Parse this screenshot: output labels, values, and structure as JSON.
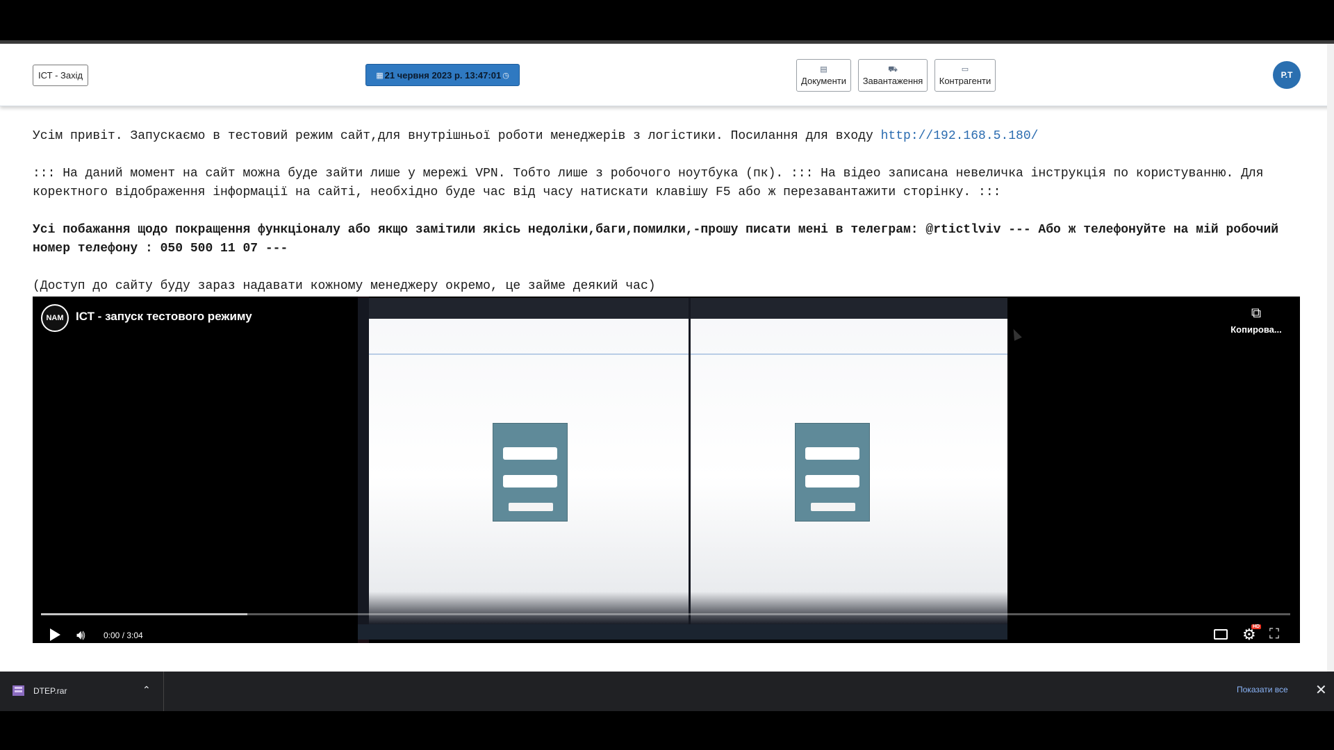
{
  "navbar": {
    "brand": "ІСТ - Захід",
    "datetime": "21 червня 2023 р. 13:47:01",
    "buttons": [
      {
        "label": "Документи",
        "icon": "document-icon"
      },
      {
        "label": "Завантаження",
        "icon": "truck-icon"
      },
      {
        "label": "Контрагенти",
        "icon": "contacts-icon"
      }
    ],
    "user_initials": "Р.Т"
  },
  "announcement": {
    "p1_text": "Усім привіт. Запускаємо в тестовий режим сайт,для внутрішньої роботи менеджерів з логістики. Посилання для входу ",
    "p1_link": "http://192.168.5.180/",
    "p2": "::: На даний момент на сайт можна буде зайти лише у мережі VPN. Тобто лише з робочого ноутбука (пк). ::: На відео записана невеличка інструкція по користуванню. Для коректного відображення інформації на сайті, необхідно буде час від часу натискати клавішу F5 або ж перезавантажити сторінку. :::",
    "p3": "Усі побажання щодо покращення функціоналу або якщо замітили якісь недоліки,баги,помилки,-прошу писати мені в телеграм: @rtictlviv --- Або ж телефонуйте на мій робочий номер телефону : 050 500 11 07 ---",
    "p4": "(Доступ до сайту буду зараз надавати кожному менеджеру окремо, це займе деякий час)"
  },
  "video": {
    "channel_logo": "NAM",
    "title": "ІСТ - запуск тестового режиму",
    "copy_label": "Копирова...",
    "time": "0:00 / 3:04",
    "buffered_fraction": 0.165,
    "hd_badge": "HD"
  },
  "downloads": {
    "file_name": "DTEP.rar",
    "show_all": "Показати все"
  }
}
